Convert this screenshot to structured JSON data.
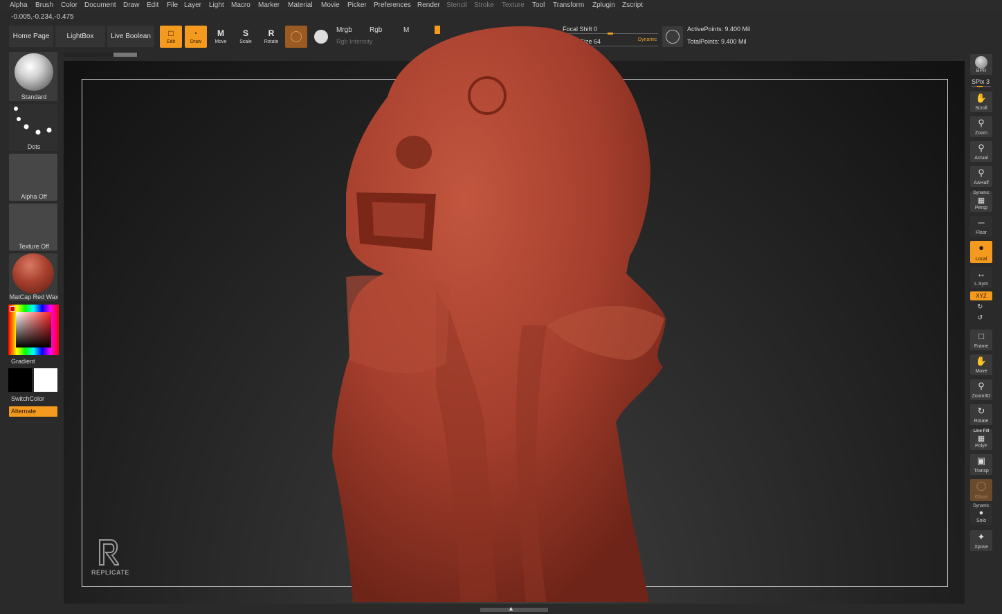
{
  "menu": [
    "Alpha",
    "Brush",
    "Color",
    "Document",
    "Draw",
    "Edit",
    "File",
    "Layer",
    "Light",
    "Macro",
    "Marker",
    "Material",
    "Movie",
    "Picker",
    "Preferences",
    "Render",
    "Stencil",
    "Stroke",
    "Texture",
    "Tool",
    "Transform",
    "Zplugin",
    "Zscript"
  ],
  "coords": "-0.005,-0.234,-0.475",
  "nav": {
    "home": "Home Page",
    "lightbox": "LightBox",
    "live_boolean": "Live Boolean"
  },
  "transform_tools": {
    "edit": "Edit",
    "draw": "Draw",
    "move": "Move",
    "scale": "Scale",
    "rotate": "Rotate"
  },
  "color_mode": {
    "mrgb": "Mrgb",
    "rgb": "Rgb",
    "m": "M",
    "rgb_intensity": "Rgb Intensity"
  },
  "brush_params": {
    "focal_shift": "Focal Shift 0",
    "draw_size": "Size 64",
    "dynamic": "Dynamic",
    "focal_shift_level": 0.5
  },
  "stats": {
    "active_points": "ActivePoints: 9.400 Mil",
    "total_points": "TotalPoints: 9.400 Mil"
  },
  "left_tray": {
    "brush": "Standard",
    "stroke": "Dots",
    "alpha": "Alpha Off",
    "texture": "Texture Off",
    "material": "MatCap Red Wax",
    "gradient": "Gradient",
    "switch_color": "SwitchColor",
    "alternate": "Alternate"
  },
  "right_tray": {
    "bpr": "BPR",
    "spix": "SPix 3",
    "scroll": "Scroll",
    "zoom": "Zoom",
    "actual": "Actual",
    "aahalf": "AAHalf",
    "persp_top": "Dynamic",
    "persp": "Persp",
    "floor": "Floor",
    "local": "Local",
    "lsym": "L.Sym",
    "xyz": "XYZ",
    "frame": "Frame",
    "move": "Move",
    "zoom3d": "Zoom3D",
    "rotate": "Rotate",
    "polyf_top": "Line Fill",
    "polyf": "PolyF",
    "transp": "Transp",
    "ghost": "Ghost",
    "solo_top": "Dynamic",
    "solo": "Solo",
    "xpose": "Xpose"
  },
  "watermark": "REPLICATE",
  "colors": {
    "accent": "#f39a1f",
    "model": "#a8402f",
    "frame": "#cfcfcf",
    "bg": "#2a2a2a"
  }
}
